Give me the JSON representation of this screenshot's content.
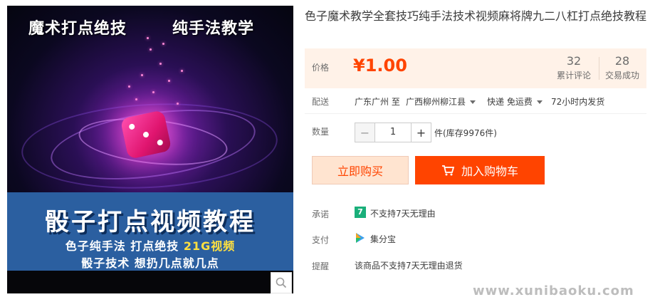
{
  "product_image": {
    "caption_left": "魔术打点绝技",
    "caption_right": "纯手法教学",
    "banner_title": "骰子打点视频教程",
    "banner_line1_a": "色子纯手法 打点绝技 ",
    "banner_line1_b": "21G视频",
    "banner_line2": "骰子技术 想扔几点就几点"
  },
  "product": {
    "title": "色子魔术教学全套技巧纯手法技术视频麻将牌九二八杠打点绝技教程"
  },
  "price": {
    "label": "价格",
    "value": "¥1.00",
    "reviews_count": "32",
    "reviews_label": "累计评论",
    "deals_count": "28",
    "deals_label": "交易成功"
  },
  "shipping": {
    "label": "配送",
    "from": "广东广州 至",
    "to": "广西柳州柳江县",
    "method": "快递 免运费",
    "dispatch": "72小时内发货"
  },
  "quantity": {
    "label": "数量",
    "minus": "−",
    "value": "1",
    "plus": "+",
    "stock": "件(库存9976件)"
  },
  "actions": {
    "buy_now": "立即购买",
    "add_to_cart": "加入购物车"
  },
  "promise": {
    "label": "承诺",
    "badge": "7",
    "text": "不支持7天无理由"
  },
  "payment": {
    "label": "支付",
    "text": "集分宝"
  },
  "reminder": {
    "label": "提醒",
    "text": "该商品不支持7天无理由退货"
  },
  "watermark": "www.xunibaoku.com",
  "colors": {
    "accent": "#ff4400",
    "price_bg": "#fff2e8",
    "buy_bg": "#ffe4d0",
    "promise_green": "#1aaf7a",
    "banner_blue": "#2b5fa0"
  },
  "icons": [
    "search-icon",
    "chevron-down-icon",
    "cart-icon",
    "seven-day-badge-icon",
    "jifenbao-icon"
  ]
}
